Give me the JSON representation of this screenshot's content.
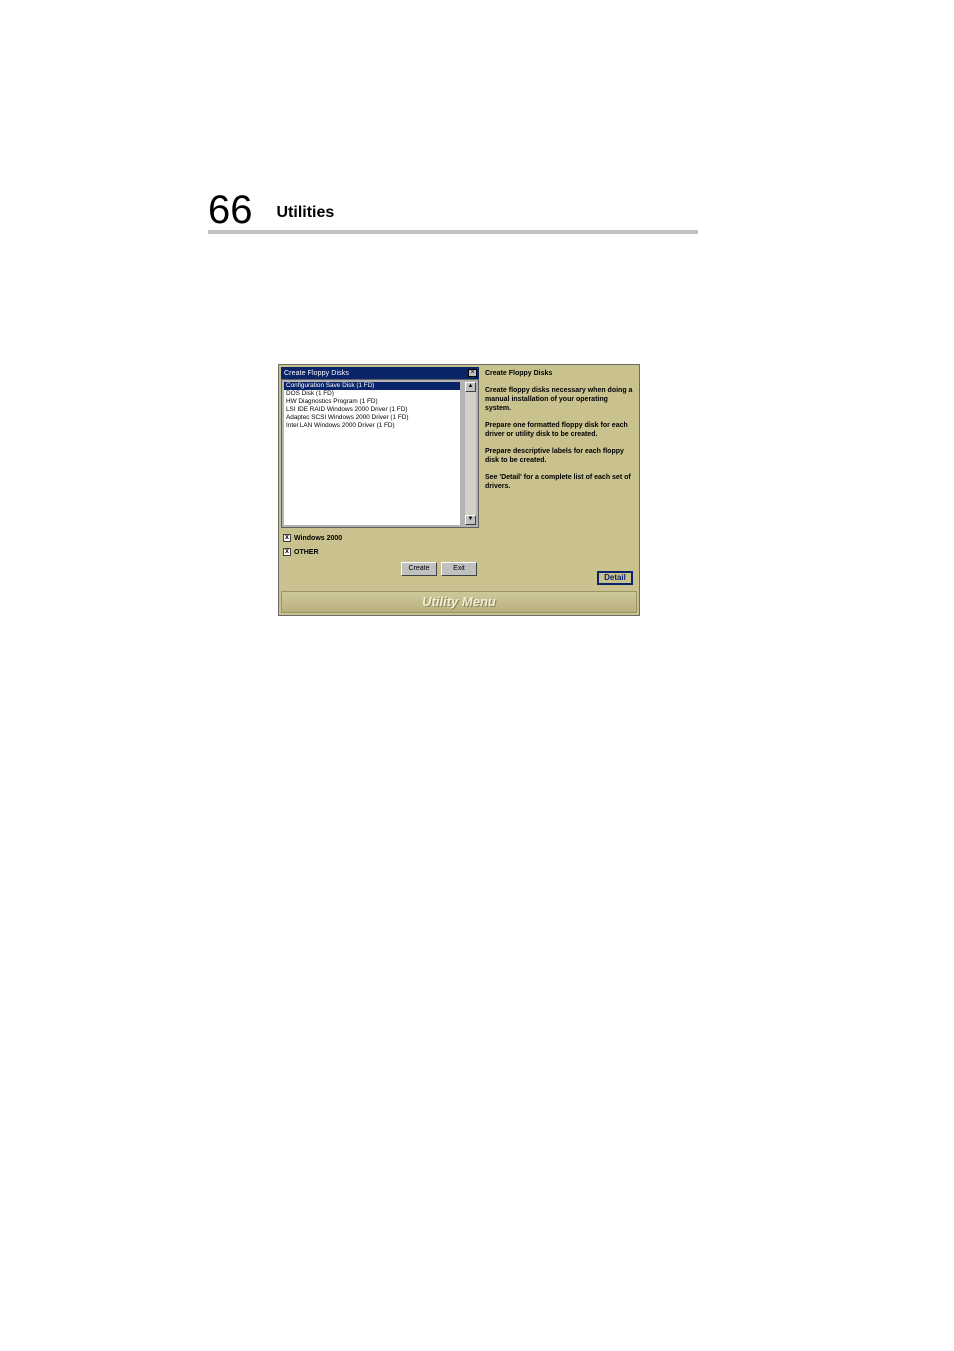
{
  "page": {
    "number": "66",
    "title": "Utilities"
  },
  "screenshot": {
    "titlebar": "Create Floppy Disks",
    "list_items": [
      "Configuration Save Disk (1 FD)",
      "DOS Disk (1 FD)",
      "HW Diagnostics Program (1 FD)",
      "LSI IDE RAID Windows 2000 Driver (1 FD)",
      "Adaptec SCSI Windows 2000 Driver (1 FD)",
      "Intel LAN Windows 2000 Driver (1 FD)"
    ],
    "checkbox1": "Windows 2000",
    "checkbox2": "OTHER",
    "create_btn": "Create",
    "exit_btn": "Exit",
    "info_heading": "Create Floppy Disks",
    "info_p1": "Create floppy disks necessary when doing a manual installation of your operating system.",
    "info_p2": "Prepare one formatted floppy disk for each driver or utility disk to be created.",
    "info_p3": "Prepare descriptive labels for each floppy disk to be created.",
    "info_p4": "See 'Detail' for a complete list of each set of drivers.",
    "detail_btn": "Detail",
    "footer": "Utility Menu"
  }
}
